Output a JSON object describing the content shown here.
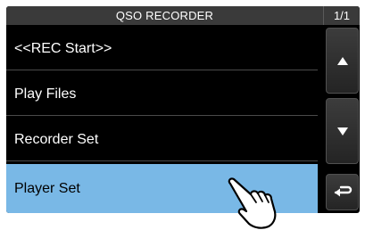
{
  "header": {
    "title": "QSO RECORDER",
    "page_indicator": "1/1"
  },
  "menu": {
    "items": [
      {
        "label": "<<REC Start>>"
      },
      {
        "label": "Play Files"
      },
      {
        "label": "Recorder Set"
      },
      {
        "label": "Player Set",
        "selected": true
      }
    ]
  },
  "side_buttons": {
    "up_icon": "triangle-up-icon",
    "down_icon": "triangle-down-icon",
    "back_icon": "return-arrow-icon"
  },
  "colors": {
    "screen_background": "#000000",
    "title_bar": "#3a3a3a",
    "selected_item": "#79b8e6",
    "text": "#ffffff"
  },
  "overlay": {
    "icon": "pointing-hand-icon"
  }
}
